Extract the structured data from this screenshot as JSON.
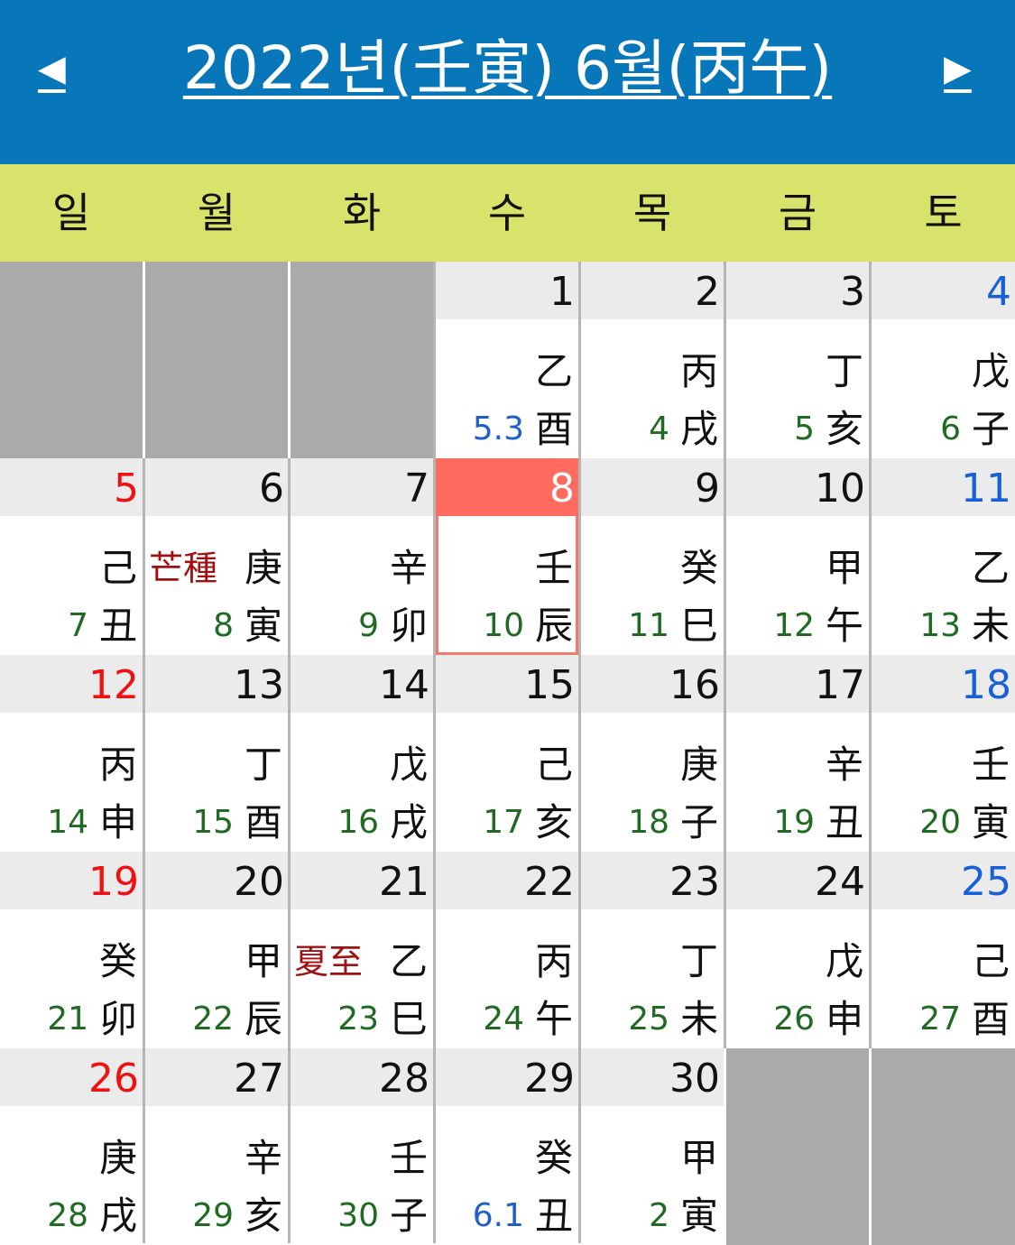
{
  "header": {
    "title": "2022년(壬寅) 6월(丙午)",
    "prev_label": "◀",
    "next_label": "▶"
  },
  "weekdays": [
    "일",
    "월",
    "화",
    "수",
    "목",
    "금",
    "토"
  ],
  "colors": {
    "header_bg": "#0777ba",
    "weekbar_bg": "#d7e36a",
    "sunday": "#ee1111",
    "saturday": "#1860d8",
    "today_bg": "#ff6b5f",
    "lunar_day": "#1f6b22",
    "lunar_month_start": "#1f5fc8",
    "solar_term": "#a01010"
  },
  "calendar": {
    "leading_blanks": 3,
    "trailing_blanks": 2,
    "days": [
      {
        "day": "1",
        "stem": "乙",
        "branch": "酉",
        "lunar": "5.3",
        "lunar_month": true
      },
      {
        "day": "2",
        "stem": "丙",
        "branch": "戌",
        "lunar": "4"
      },
      {
        "day": "3",
        "stem": "丁",
        "branch": "亥",
        "lunar": "5"
      },
      {
        "day": "4",
        "stem": "戊",
        "branch": "子",
        "lunar": "6"
      },
      {
        "day": "5",
        "stem": "己",
        "branch": "丑",
        "lunar": "7"
      },
      {
        "day": "6",
        "stem": "庚",
        "branch": "寅",
        "lunar": "8",
        "term": "芒種"
      },
      {
        "day": "7",
        "stem": "辛",
        "branch": "卯",
        "lunar": "9"
      },
      {
        "day": "8",
        "stem": "壬",
        "branch": "辰",
        "lunar": "10",
        "today": true
      },
      {
        "day": "9",
        "stem": "癸",
        "branch": "巳",
        "lunar": "11"
      },
      {
        "day": "10",
        "stem": "甲",
        "branch": "午",
        "lunar": "12"
      },
      {
        "day": "11",
        "stem": "乙",
        "branch": "未",
        "lunar": "13"
      },
      {
        "day": "12",
        "stem": "丙",
        "branch": "申",
        "lunar": "14"
      },
      {
        "day": "13",
        "stem": "丁",
        "branch": "酉",
        "lunar": "15"
      },
      {
        "day": "14",
        "stem": "戊",
        "branch": "戌",
        "lunar": "16"
      },
      {
        "day": "15",
        "stem": "己",
        "branch": "亥",
        "lunar": "17"
      },
      {
        "day": "16",
        "stem": "庚",
        "branch": "子",
        "lunar": "18"
      },
      {
        "day": "17",
        "stem": "辛",
        "branch": "丑",
        "lunar": "19"
      },
      {
        "day": "18",
        "stem": "壬",
        "branch": "寅",
        "lunar": "20"
      },
      {
        "day": "19",
        "stem": "癸",
        "branch": "卯",
        "lunar": "21"
      },
      {
        "day": "20",
        "stem": "甲",
        "branch": "辰",
        "lunar": "22"
      },
      {
        "day": "21",
        "stem": "乙",
        "branch": "巳",
        "lunar": "23",
        "term": "夏至"
      },
      {
        "day": "22",
        "stem": "丙",
        "branch": "午",
        "lunar": "24"
      },
      {
        "day": "23",
        "stem": "丁",
        "branch": "未",
        "lunar": "25"
      },
      {
        "day": "24",
        "stem": "戊",
        "branch": "申",
        "lunar": "26"
      },
      {
        "day": "25",
        "stem": "己",
        "branch": "酉",
        "lunar": "27"
      },
      {
        "day": "26",
        "stem": "庚",
        "branch": "戌",
        "lunar": "28"
      },
      {
        "day": "27",
        "stem": "辛",
        "branch": "亥",
        "lunar": "29"
      },
      {
        "day": "28",
        "stem": "壬",
        "branch": "子",
        "lunar": "30"
      },
      {
        "day": "29",
        "stem": "癸",
        "branch": "丑",
        "lunar": "6.1",
        "lunar_month": true
      },
      {
        "day": "30",
        "stem": "甲",
        "branch": "寅",
        "lunar": "2"
      }
    ]
  }
}
